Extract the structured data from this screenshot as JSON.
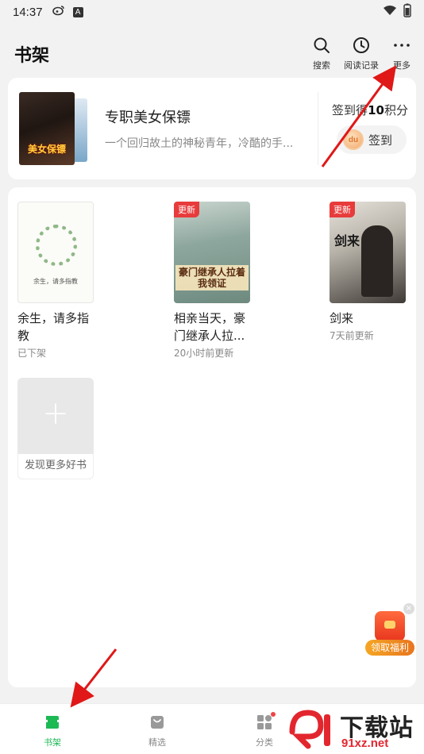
{
  "status_bar": {
    "time": "14:37",
    "a_icon": "A",
    "icons": [
      "weibo-icon",
      "a-icon",
      "wifi-icon",
      "battery-icon"
    ]
  },
  "header": {
    "title": "书架",
    "search_label": "搜索",
    "history_label": "阅读记录",
    "more_label": "更多"
  },
  "featured": {
    "title": "专职美女保镖",
    "desc": "一个回归故土的神秘青年，冷酷的手...",
    "cover_text": "美女保镖",
    "checkin_prefix": "签到得",
    "checkin_points": "10",
    "checkin_suffix": "积分",
    "coin_text": "du",
    "checkin_button": "签到"
  },
  "books": [
    {
      "title": "余生，请多指教",
      "status": "已下架",
      "badge": "",
      "cover_text": "余生，请多指教"
    },
    {
      "title": "相亲当天，豪门继承人拉...",
      "status": "20小时前更新",
      "badge": "更新",
      "cover_text": "豪门继承人拉着我领证"
    },
    {
      "title": "剑来",
      "status": "7天前更新",
      "badge": "更新",
      "cover_text": "剑来"
    }
  ],
  "discover": {
    "label": "发现更多好书"
  },
  "welfare": {
    "label": "领取福利"
  },
  "tabs": [
    {
      "label": "书架",
      "active": true
    },
    {
      "label": "精选",
      "active": false
    },
    {
      "label": "分类",
      "active": false
    }
  ],
  "watermark": {
    "text": "下载站",
    "url": "91xz.net"
  },
  "colors": {
    "accent": "#1db954",
    "badge": "#e83b3b",
    "arrow": "#e01818",
    "welfare": "#f5a623"
  }
}
